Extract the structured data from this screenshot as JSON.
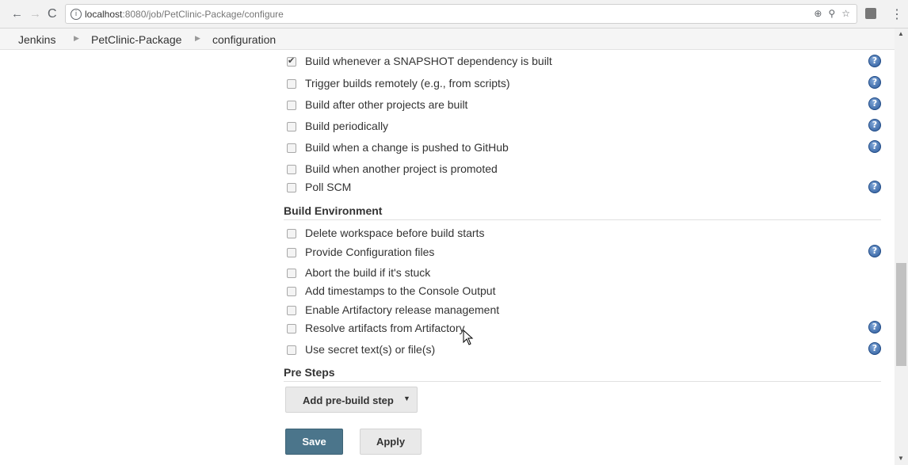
{
  "browser": {
    "url_host": "localhost",
    "url_path": ":8080/job/PetClinic-Package/configure",
    "icons": [
      "back-arrow-icon",
      "forward-arrow-icon",
      "reload-icon",
      "info-icon",
      "zoom-icon",
      "key-icon",
      "star-icon",
      "extension-icon",
      "menu-icon"
    ]
  },
  "breadcrumb": {
    "items": [
      "Jenkins",
      "PetClinic-Package",
      "configuration"
    ]
  },
  "build_triggers": [
    {
      "label": "Build whenever a SNAPSHOT dependency is built",
      "checked": true,
      "help": true
    },
    {
      "label": "Trigger builds remotely (e.g., from scripts)",
      "checked": false,
      "help": true
    },
    {
      "label": "Build after other projects are built",
      "checked": false,
      "help": true
    },
    {
      "label": "Build periodically",
      "checked": false,
      "help": true
    },
    {
      "label": "Build when a change is pushed to GitHub",
      "checked": false,
      "help": true
    },
    {
      "label": "Build when another project is promoted",
      "checked": false,
      "help": false
    },
    {
      "label": "Poll SCM",
      "checked": false,
      "help": true
    }
  ],
  "build_environment": {
    "title": "Build Environment",
    "options": [
      {
        "label": "Delete workspace before build starts",
        "checked": false,
        "help": false
      },
      {
        "label": "Provide Configuration files",
        "checked": false,
        "help": true
      },
      {
        "label": "Abort the build if it's stuck",
        "checked": false,
        "help": false
      },
      {
        "label": "Add timestamps to the Console Output",
        "checked": false,
        "help": false
      },
      {
        "label": "Enable Artifactory release management",
        "checked": false,
        "help": false
      },
      {
        "label": "Resolve artifacts from Artifactory",
        "checked": false,
        "help": true
      },
      {
        "label": "Use secret text(s) or file(s)",
        "checked": false,
        "help": true
      }
    ]
  },
  "pre_steps": {
    "title": "Pre Steps",
    "add_button": "Add pre-build step"
  },
  "actions": {
    "save": "Save",
    "apply": "Apply"
  },
  "help_glyph": "?",
  "colors": {
    "save_button": "#4b758b",
    "help_icon": "#2c5a9a"
  }
}
